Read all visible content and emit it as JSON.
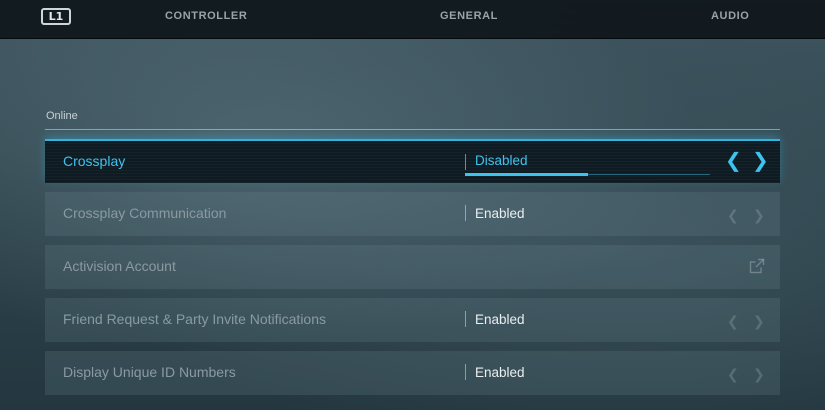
{
  "nav": {
    "bumper_label": "L1",
    "tabs": [
      {
        "label": "CONTROLLER"
      },
      {
        "label": "GENERAL"
      },
      {
        "label": "AUDIO"
      }
    ]
  },
  "section": {
    "title": "Online"
  },
  "settings": [
    {
      "label": "Crossplay",
      "value": "Disabled",
      "selected": true,
      "value_fill_fraction": 0.5,
      "left_arrow": "chevron-left-icon",
      "right_arrow": "chevron-right-icon"
    },
    {
      "label": "Crossplay Communication",
      "value": "Enabled",
      "selected": false,
      "left_arrow": "chevron-left-icon",
      "right_arrow": "chevron-right-icon"
    },
    {
      "label": "Activision Account",
      "selected": false,
      "icon": "external-link-icon"
    },
    {
      "label": "Friend Request & Party Invite Notifications",
      "value": "Enabled",
      "selected": false,
      "left_arrow": "chevron-left-icon",
      "right_arrow": "chevron-right-icon"
    },
    {
      "label": "Display Unique ID Numbers",
      "value": "Enabled",
      "selected": false,
      "left_arrow": "chevron-left-icon",
      "right_arrow": "chevron-right-icon"
    }
  ],
  "colors": {
    "accent": "#3ec3ee",
    "nav_bg": "#0e161a",
    "selected_row_bg": "#0f1b22"
  }
}
